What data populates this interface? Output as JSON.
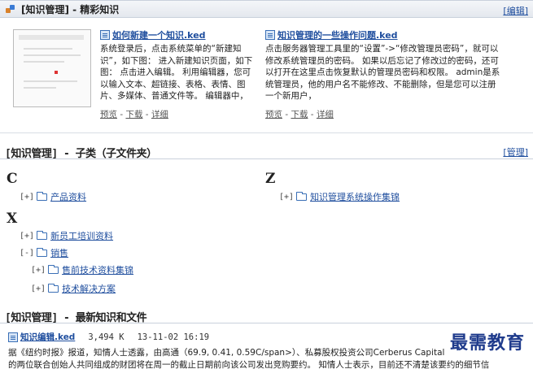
{
  "featured_panel": {
    "title": "[知识管理] - 精彩知识",
    "edit_link": "[编辑]",
    "articles": [
      {
        "title": "如何新建一个知识",
        "ext": ".ked",
        "body": "系统登录后，点击系统菜单的“新建知识”，如下图： 进入新建知识页面，如下图： 点击进入编辑。 利用编辑器，您可以输入文本、超链接、表格、表情、图片、多媒体、普通文件等。 编辑器中，",
        "actions": [
          "预览",
          "下载",
          "详细"
        ]
      },
      {
        "title": "知识管理的一些操作问题",
        "ext": ".ked",
        "body": "点击服务器管理工具里的“设置”->“修改管理员密码”，就可以修改系统管理员的密码。 如果以后忘记了修改过的密码，还可以打开在这里点击恢复默认的管理员密码和权限。 admin是系统管理员，他的用户名不能修改、不能删除，但是您可以注册一个新用户，",
        "actions": [
          "预览",
          "下载",
          "详细"
        ]
      }
    ]
  },
  "subcategory_section": {
    "title": "[知识管理] - 子类（子文件夹）",
    "manage_link": "[管理]",
    "groups": [
      {
        "letter": "C",
        "items": [
          {
            "toggle": "[+]",
            "label": "产品资料"
          }
        ]
      },
      {
        "letter": "Z",
        "items": [
          {
            "toggle": "[+]",
            "label": "知识管理系统操作集锦"
          }
        ]
      },
      {
        "letter": "X",
        "items": [
          {
            "toggle": "[+]",
            "label": "新员工培训资料"
          },
          {
            "toggle": "[-]",
            "label": "销售"
          },
          {
            "toggle": "[+]",
            "label": "售前技术资料集锦"
          },
          {
            "toggle": "[+]",
            "label": "技术解决方案"
          }
        ]
      }
    ]
  },
  "latest_section": {
    "title": "[知识管理] - 最新知识和文件",
    "item": {
      "name": "知识编辑",
      "ext": ".ked",
      "size": "3,494 K",
      "date": "13-11-02 16:19",
      "body_line1": "据《纽约时报》报道，知情人士透露，由高通（69.9, 0.41, 0.59C/span>）、私募股权投资公司Cerberus Capital",
      "body_line2": "的两位联合创始人共同组成的财团将在周一的截止日期前向该公司发出竞购要约。     知情人士表示，目前还不清楚该要约的细节信"
    }
  },
  "watermark": "最需教育",
  "icons": {
    "panel": "knowledge-tree-icon",
    "doc": "ked-document-icon",
    "folder": "folder-icon"
  },
  "colors": {
    "link": "#1f4e9e",
    "header_bg": "#e8ecf1",
    "watermark": "#1f3b8c"
  }
}
